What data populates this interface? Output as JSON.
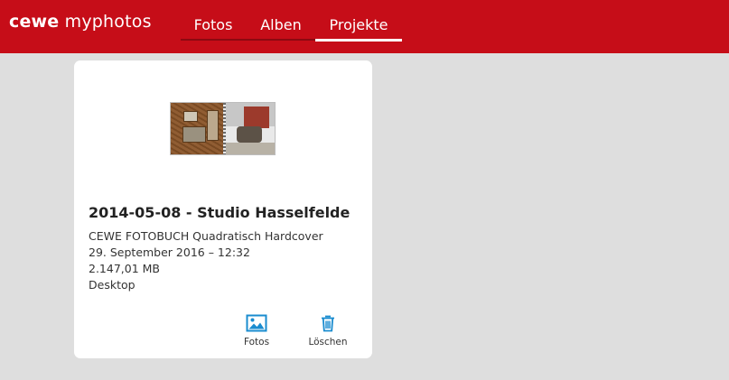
{
  "header": {
    "logo_brand": "cewe",
    "logo_product": "myphotos",
    "background_color": "#c60d18",
    "tabs": [
      {
        "label": "Fotos",
        "active": false
      },
      {
        "label": "Alben",
        "active": false
      },
      {
        "label": "Projekte",
        "active": true
      }
    ]
  },
  "project": {
    "title": "2014-05-08 - Studio Hasselfelde",
    "product": "CEWE FOTOBUCH Quadratisch Hardcover",
    "date": "29. September 2016 – 12:32",
    "size": "2.147,01 MB",
    "source": "Desktop",
    "thumbnail_icon": "photobook-thumbnail",
    "actions": [
      {
        "label": "Fotos",
        "icon": "image-icon",
        "color": "#1a8ccf"
      },
      {
        "label": "Löschen",
        "icon": "trash-icon",
        "color": "#1a8ccf"
      }
    ]
  }
}
